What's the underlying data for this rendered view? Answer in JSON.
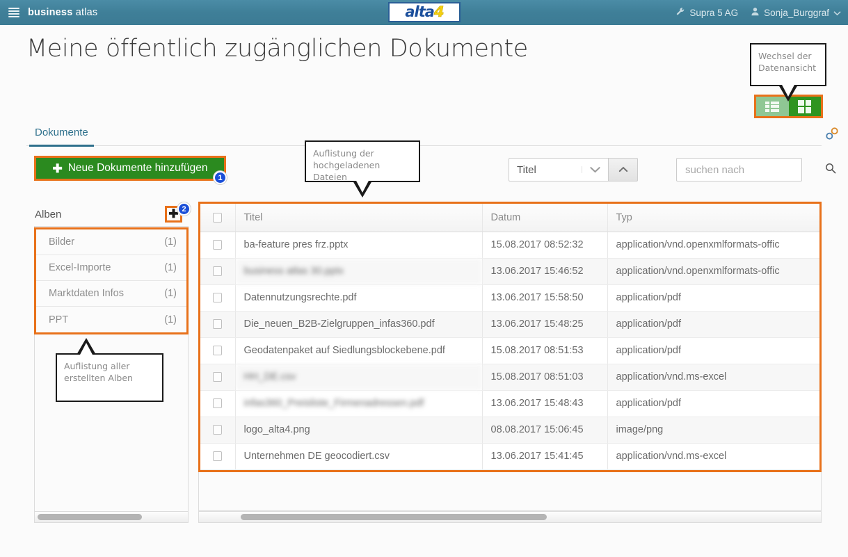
{
  "topbar": {
    "menu_icon": "hamburger-icon",
    "brand_bold": "business",
    "brand_light": " atlas",
    "logo_text_main": "alta",
    "logo_text_accent": "4",
    "org_icon": "wrench-icon",
    "org_name": "Supra 5 AG",
    "user_icon": "user-icon",
    "user_name": "Sonja_Burggraf",
    "user_caret": "chevron-down-icon",
    "bg_color": "#3f7f98"
  },
  "page_title": "Meine öffentlich zugänglichen Dokumente",
  "callouts": {
    "view_switch": "Wechsel der Datenansicht",
    "file_list": "Auflistung der hochgeladenen Dateien",
    "album_list": "Auflistung aller erstellten Alben"
  },
  "view_switch": {
    "list_icon": "list-view-icon",
    "grid_icon": "grid-view-icon",
    "active": "grid",
    "highlight_color": "#e8711a",
    "list_color": "#8fc794",
    "grid_color": "#2f9420"
  },
  "tabs": [
    {
      "label": "Dokumente",
      "active": true
    }
  ],
  "link_icon": "chain-link-icon",
  "toolbar": {
    "add_documents_label": "Neue Dokumente hinzufügen",
    "add_documents_plus": "✚",
    "add_button_color": "#2b8a1f",
    "badge_1": "1",
    "badge_2": "2",
    "badge_color": "#1b4fd8"
  },
  "sort": {
    "selected_field": "Titel",
    "chevron_icon": "chevron-down-icon",
    "direction_icon": "sort-ascending-icon"
  },
  "search": {
    "value": "",
    "placeholder": "suchen nach",
    "icon": "search-icon"
  },
  "albums": {
    "label": "Alben",
    "add_icon": "plus-icon",
    "add_glyph": "✚",
    "items": [
      {
        "name": "Bilder",
        "count": "(1)"
      },
      {
        "name": "Excel-Importe",
        "count": "(1)"
      },
      {
        "name": "Marktdaten Infos",
        "count": "(1)"
      },
      {
        "name": "PPT",
        "count": "(1)"
      }
    ]
  },
  "table": {
    "columns": [
      "",
      "Titel",
      "Datum",
      "Typ"
    ],
    "rows": [
      {
        "title": "ba-feature pres frz.pptx",
        "date": "15.08.2017 08:52:32",
        "type": "application/vnd.openxmlformats-offic",
        "blurred": false
      },
      {
        "title": "business atlas 30.pptx",
        "date": "13.06.2017 15:46:52",
        "type": "application/vnd.openxmlformats-offic",
        "blurred": true
      },
      {
        "title": "Datennutzungsrechte.pdf",
        "date": "13.06.2017 15:58:50",
        "type": "application/pdf",
        "blurred": false
      },
      {
        "title": "Die_neuen_B2B-Zielgruppen_infas360.pdf",
        "date": "13.06.2017 15:48:25",
        "type": "application/pdf",
        "blurred": false
      },
      {
        "title": "Geodatenpaket auf Siedlungsblockebene.pdf",
        "date": "15.08.2017 08:51:53",
        "type": "application/pdf",
        "blurred": false
      },
      {
        "title": "HH_DE.csv",
        "date": "15.08.2017 08:51:03",
        "type": "application/vnd.ms-excel",
        "blurred": true
      },
      {
        "title": "infas360_Preisliste_Firmenadressen.pdf",
        "date": "13.06.2017 15:48:43",
        "type": "application/pdf",
        "blurred": true
      },
      {
        "title": "logo_alta4.png",
        "date": "08.08.2017 15:06:45",
        "type": "image/png",
        "blurred": false
      },
      {
        "title": "Unternehmen DE geocodiert.csv",
        "date": "13.06.2017 15:41:45",
        "type": "application/vnd.ms-excel",
        "blurred": false
      }
    ],
    "highlight_color": "#e8711a"
  },
  "scrollbars": {
    "left_thumb_icon": "horizontal-scrollbar-thumb",
    "right_thumb_icon": "horizontal-scrollbar-thumb"
  }
}
